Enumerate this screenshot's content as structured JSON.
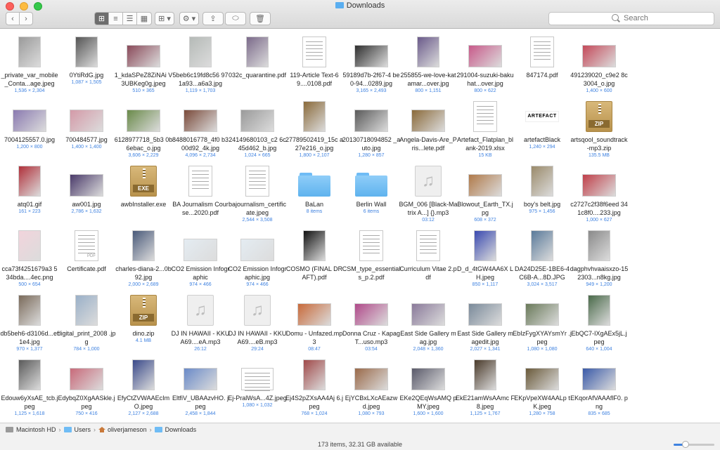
{
  "window": {
    "title": "Downloads"
  },
  "toolbar": {
    "back": "‹",
    "forward": "›",
    "view_icons": "⊞",
    "view_list": "≡",
    "view_columns": "☰",
    "view_gallery": "▦",
    "arrange": "⊞ ▾",
    "action": "⚙ ▾",
    "share": "⇪",
    "tag": "⬭"
  },
  "search": {
    "placeholder": "Search"
  },
  "files": [
    {
      "name": "_private_var_mobile_Conta...age.jpeg",
      "meta": "1,536 × 2,304",
      "kind": "photo",
      "color": "#9a9a9a",
      "tall": true
    },
    {
      "name": "0YtiRdG.jpg",
      "meta": "1,087 × 1,505",
      "kind": "photo",
      "color": "#555555",
      "tall": true
    },
    {
      "name": "1_kdaSPeZ8ZiNAi V3UBKeg0g.jpeg",
      "meta": "510 × 365",
      "kind": "photo",
      "color": "#8a4a5a",
      "tall": false
    },
    {
      "name": "5beb6c19fd8c56 971a93...a6a3.jpg",
      "meta": "1,119 × 1,703",
      "kind": "photo",
      "color": "#b5bab7",
      "tall": true
    },
    {
      "name": "032c_quarantine.pdf",
      "meta": "",
      "kind": "photo",
      "color": "#7b6a8a",
      "tall": true
    },
    {
      "name": "119-Article Text-69....0108.pdf",
      "meta": "",
      "kind": "doc",
      "color": "#ffffff",
      "tall": true
    },
    {
      "name": "59189d7b-2f67-4 be0-94...0289.jpg",
      "meta": "3,165 × 2,493",
      "kind": "photo",
      "color": "#2f2f2f",
      "tall": false
    },
    {
      "name": "255855-we-love-katamar...over.jpg",
      "meta": "800 × 1,151",
      "kind": "photo",
      "color": "#6a5a8a",
      "tall": true
    },
    {
      "name": "291004-suzuki-bakuhat...over.jpg",
      "meta": "800 × 622",
      "kind": "photo",
      "color": "#c85a8a",
      "tall": false
    },
    {
      "name": "847174.pdf",
      "meta": "",
      "kind": "doc",
      "color": "#ffffff",
      "tall": true
    },
    {
      "name": "491239020_c9e2 8c3004_o.jpg",
      "meta": "1,400 × 600",
      "kind": "photo",
      "color": "#c44a5a",
      "tall": false
    },
    {
      "name": "7004125557.0.jpg",
      "meta": "1,200 × 800",
      "kind": "photo",
      "color": "#8a7ab0",
      "tall": false
    },
    {
      "name": "700484577.jpg",
      "meta": "1,400 × 1,400",
      "kind": "photo",
      "color": "#d49aa8",
      "tall": false
    },
    {
      "name": "6128977718_5b3 0b6ebac_o.jpg",
      "meta": "3,606 × 2,229",
      "kind": "photo",
      "color": "#6a8a4a",
      "tall": false
    },
    {
      "name": "8488016778_4f0 b300d92_4k.jpg",
      "meta": "4,096 × 2,734",
      "kind": "photo",
      "color": "#7a4a3a",
      "tall": false
    },
    {
      "name": "24149680103_c2 6c45d462_b.jpg",
      "meta": "1,024 × 665",
      "kind": "photo",
      "color": "#9a9a9a",
      "tall": false
    },
    {
      "name": "27789502419_15c a27e216_o.jpg",
      "meta": "1,800 × 2,107",
      "kind": "photo",
      "color": "#8a6a3a",
      "tall": true
    },
    {
      "name": "20130718094852 _auto.jpg",
      "meta": "1,280 × 857",
      "kind": "photo",
      "color": "#5a5a5a",
      "tall": false
    },
    {
      "name": "Angela-Davis-Are_Pris...lete.pdf",
      "meta": "",
      "kind": "photo",
      "color": "#8a6a3a",
      "tall": false
    },
    {
      "name": "Artefact_Flatplan_blank-2019.xlsx",
      "meta": "15 KB",
      "kind": "doc",
      "color": "#ffffff",
      "tall": true
    },
    {
      "name": "artefactBlack",
      "meta": "1,240 × 294",
      "kind": "text",
      "color": "#000000",
      "tall": false,
      "label": "ARTEFACT"
    },
    {
      "name": "artsqool_soundtrack-mp3.zip",
      "meta": "135.5 MB",
      "kind": "zip",
      "color": "#c8a464",
      "tall": true
    },
    {
      "name": "atq01.gif",
      "meta": "161 × 223",
      "kind": "photo",
      "color": "#b0303a",
      "tall": true
    },
    {
      "name": "aw001.jpg",
      "meta": "2,786 × 1,632",
      "kind": "photo",
      "color": "#4a3a6a",
      "tall": false
    },
    {
      "name": "awbInstaller.exe",
      "meta": "",
      "kind": "zip",
      "color": "#c8a464",
      "tall": true,
      "label": "EXE"
    },
    {
      "name": "BA Journalism Course...2020.pdf",
      "meta": "",
      "kind": "doc",
      "color": "#ffffff",
      "tall": true
    },
    {
      "name": "bajournalism_certificate.jpeg",
      "meta": "2,544 × 3,508",
      "kind": "doc",
      "color": "#ffffff",
      "tall": true
    },
    {
      "name": "BaLan",
      "meta": "8 items",
      "kind": "folder",
      "color": "#6fbcf5",
      "tall": false
    },
    {
      "name": "Berlin Wall",
      "meta": "6 items",
      "kind": "folder",
      "color": "#6fbcf5",
      "tall": false
    },
    {
      "name": "BGM_006 [Black-Matrix A...] {}.mp3",
      "meta": "03:12",
      "kind": "audio",
      "color": "#efefef",
      "tall": true
    },
    {
      "name": "Blowout_Earth_TX.jpg",
      "meta": "608 × 372",
      "kind": "photo",
      "color": "#b07a4a",
      "tall": false
    },
    {
      "name": "boy's belt.jpg",
      "meta": "975 × 1,456",
      "kind": "photo",
      "color": "#9a8a6a",
      "tall": true
    },
    {
      "name": "c2727c2f38f6eed 341c8f0....233.jpg",
      "meta": "1,000 × 627",
      "kind": "photo",
      "color": "#c0404a",
      "tall": false
    },
    {
      "name": "cca73f4251679a3 534bda....4ec.png",
      "meta": "500 × 654",
      "kind": "photo",
      "color": "#f2d4dc",
      "tall": true
    },
    {
      "name": "Certificate.pdf",
      "meta": "",
      "kind": "doc",
      "color": "#ffffff",
      "tall": true,
      "label": "PDF"
    },
    {
      "name": "charles-diana-2...0b92.jpg",
      "meta": "2,000 × 2,689",
      "kind": "photo",
      "color": "#4a5a7a",
      "tall": true
    },
    {
      "name": "CO2 Emission Infographic",
      "meta": "974 × 466",
      "kind": "photo",
      "color": "#e4ecf2",
      "tall": false
    },
    {
      "name": "CO2 Emission Infographic.jpg",
      "meta": "974 × 466",
      "kind": "photo",
      "color": "#e4ecf2",
      "tall": false
    },
    {
      "name": "COSMO (FINAL DRAFT).pdf",
      "meta": "",
      "kind": "photo",
      "color": "#111111",
      "tall": true
    },
    {
      "name": "CSM_type_essentials_p.2.pdf",
      "meta": "",
      "kind": "doc",
      "color": "#ffffff",
      "tall": true
    },
    {
      "name": "Curriculum Vitae 2.pdf",
      "meta": "",
      "kind": "doc",
      "color": "#ffffff",
      "tall": true
    },
    {
      "name": "D_d_4tGW4AA6X LH.jpeg",
      "meta": "850 × 1,117",
      "kind": "photo",
      "color": "#3a4ab0",
      "tall": true
    },
    {
      "name": "DA24D25E-1BE6-4C6B-A...8D.JPG",
      "meta": "3,024 × 3,517",
      "kind": "photo",
      "color": "#5a7a9a",
      "tall": true
    },
    {
      "name": "dagphvhvaaisxzo-152303...n8kg.jpg",
      "meta": "949 × 1,200",
      "kind": "photo",
      "color": "#8a8a8a",
      "tall": true
    },
    {
      "name": "db5beh6-d3106d...ef1e4.jpg",
      "meta": "970 × 1,377",
      "kind": "photo",
      "color": "#7a6a5a",
      "tall": true
    },
    {
      "name": "digital_print_2008 .jpg",
      "meta": "784 × 1,000",
      "kind": "photo",
      "color": "#9ab0c8",
      "tall": true
    },
    {
      "name": "dino.zip",
      "meta": "4.1 MB",
      "kind": "zip",
      "color": "#c8a464",
      "tall": true
    },
    {
      "name": "DJ IN HAWAII - KKUA69....eA.mp3",
      "meta": "26:12",
      "kind": "audio",
      "color": "#efefef",
      "tall": true
    },
    {
      "name": "DJ IN HAWAII - KKUA69....eB.mp3",
      "meta": "29:24",
      "kind": "audio",
      "color": "#efefef",
      "tall": true
    },
    {
      "name": "Domu - Unfazed.mp3",
      "meta": "08:47",
      "kind": "photo",
      "color": "#c86a3a",
      "tall": false
    },
    {
      "name": "Donna Cruz - Kapag T...uso.mp3",
      "meta": "03:54",
      "kind": "photo",
      "color": "#b04a8a",
      "tall": false
    },
    {
      "name": "East Side Gallery mag.jpg",
      "meta": "2,048 × 1,360",
      "kind": "photo",
      "color": "#8a7a9a",
      "tall": false
    },
    {
      "name": "East Side Gallery magedit.jpg",
      "meta": "2,027 × 1,341",
      "kind": "photo",
      "color": "#7a8a9a",
      "tall": false
    },
    {
      "name": "EbIzFygXYAYsmYr .jpeg",
      "meta": "1,080 × 1,080",
      "kind": "photo",
      "color": "#6a7a5a",
      "tall": false
    },
    {
      "name": "EbQC7-IXgAEx5jL.jpeg",
      "meta": "640 × 1,004",
      "kind": "photo",
      "color": "#4a6a4a",
      "tall": true
    },
    {
      "name": "Edouw6yXsAE_tcb.jpeg",
      "meta": "1,125 × 1,618",
      "kind": "photo",
      "color": "#5a5a5a",
      "tall": true
    },
    {
      "name": "EdybqZ0XgAASkle.jpeg",
      "meta": "750 × 416",
      "kind": "photo",
      "color": "#c86a7a",
      "tall": false
    },
    {
      "name": "EfyCtZVWAAEcIm O.jpeg",
      "meta": "2,127 × 2,688",
      "kind": "photo",
      "color": "#3a4a8a",
      "tall": true
    },
    {
      "name": "EltfiV_UBAAzvHO. jpeg",
      "meta": "2,458 × 1,844",
      "kind": "photo",
      "color": "#6a8ac8",
      "tall": false
    },
    {
      "name": "Ej-PralWsA...4Z.jpeg",
      "meta": "1,080 × 1,032",
      "kind": "doc",
      "color": "#ffffff",
      "tall": false
    },
    {
      "name": "Ej4S2pZXsAA4Aj 6.jpeg",
      "meta": "768 × 1,024",
      "kind": "photo",
      "color": "#a04a4a",
      "tall": true
    },
    {
      "name": "EjYCBxLXcAEazw d.jpeg",
      "meta": "1,080 × 793",
      "kind": "photo",
      "color": "#9a6a4a",
      "tall": false
    },
    {
      "name": "EKe2QEqWsAMQ pMY.jpeg",
      "meta": "1,600 × 1,600",
      "kind": "photo",
      "color": "#5a5a6a",
      "tall": false
    },
    {
      "name": "EkE21amWsAAmc F8.jpeg",
      "meta": "1,125 × 1,767",
      "kind": "photo",
      "color": "#4a3a2a",
      "tall": true
    },
    {
      "name": "EKpVpeXW4AALp tK.jpeg",
      "meta": "1,280 × 758",
      "kind": "photo",
      "color": "#6a5a3a",
      "tall": false
    },
    {
      "name": "EKqorAfVAAAflF0. png",
      "meta": "835 × 685",
      "kind": "photo",
      "color": "#3a5aa8",
      "tall": false
    }
  ],
  "pathbar": {
    "items": [
      "Macintosh HD",
      "Users",
      "oliverjameson",
      "Downloads"
    ],
    "sep": "›"
  },
  "status": {
    "text": "173 items, 32.31 GB available"
  },
  "zoom": {
    "level": 0.3
  }
}
